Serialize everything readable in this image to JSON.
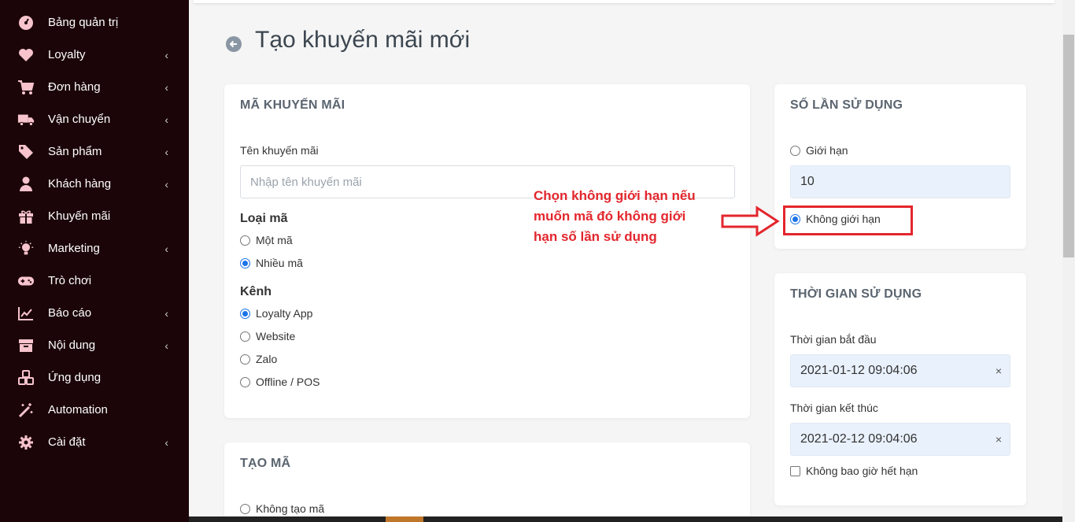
{
  "sidebar": {
    "items": [
      {
        "label": "Bảng quản trị",
        "icon": "dashboard-icon",
        "has_children": false
      },
      {
        "label": "Loyalty",
        "icon": "heart-icon",
        "has_children": true
      },
      {
        "label": "Đơn hàng",
        "icon": "cart-icon",
        "has_children": true
      },
      {
        "label": "Vận chuyển",
        "icon": "truck-icon",
        "has_children": true
      },
      {
        "label": "Sản phẩm",
        "icon": "tag-icon",
        "has_children": true
      },
      {
        "label": "Khách hàng",
        "icon": "user-icon",
        "has_children": true
      },
      {
        "label": "Khuyến mãi",
        "icon": "gift-icon",
        "has_children": false
      },
      {
        "label": "Marketing",
        "icon": "lightbulb-icon",
        "has_children": true
      },
      {
        "label": "Trò chơi",
        "icon": "gamepad-icon",
        "has_children": false
      },
      {
        "label": "Báo cáo",
        "icon": "chart-line-icon",
        "has_children": true
      },
      {
        "label": "Nội dung",
        "icon": "archive-icon",
        "has_children": true
      },
      {
        "label": "Ứng dụng",
        "icon": "cubes-icon",
        "has_children": false
      },
      {
        "label": "Automation",
        "icon": "magic-wand-icon",
        "has_children": false
      },
      {
        "label": "Cài đặt",
        "icon": "gear-icon",
        "has_children": true
      }
    ],
    "chevron": "‹",
    "icon_color": "#f7c3cd"
  },
  "page": {
    "title": "Tạo khuyến mãi mới"
  },
  "promo_card": {
    "title": "MÃ KHUYẾN MÃI",
    "name_label": "Tên khuyến mãi",
    "name_placeholder": "Nhập tên khuyến mãi",
    "name_value": "",
    "code_type_label": "Loại mã",
    "code_types": [
      {
        "label": "Một mã",
        "checked": false
      },
      {
        "label": "Nhiều mã",
        "checked": true
      }
    ],
    "channel_label": "Kênh",
    "channels": [
      {
        "label": "Loyalty App",
        "checked": true
      },
      {
        "label": "Website",
        "checked": false
      },
      {
        "label": "Zalo",
        "checked": false
      },
      {
        "label": "Offline / POS",
        "checked": false
      }
    ]
  },
  "generate_card": {
    "title": "TẠO MÃ",
    "options": [
      {
        "label": "Không tạo mã",
        "checked": false
      }
    ]
  },
  "usage_card": {
    "title": "SỐ LẦN SỬ DỤNG",
    "limited_label": "Giới hạn",
    "limited_checked": false,
    "limit_value": "10",
    "unlimited_label": "Không giới hạn",
    "unlimited_checked": true
  },
  "time_card": {
    "title": "THỜI GIAN SỬ DỤNG",
    "start_label": "Thời gian bắt đầu",
    "start_value": "2021-01-12 09:04:06",
    "end_label": "Thời gian kết thúc",
    "end_value": "2021-02-12 09:04:06",
    "clear_symbol": "×",
    "never_expire_label": "Không bao giờ hết hạn",
    "never_expire_checked": false
  },
  "annotation": {
    "lines": [
      "Chọn không giới hạn nếu",
      "muốn mã đó không giới",
      "hạn số lần sử dụng"
    ],
    "color": "#e3262d"
  }
}
